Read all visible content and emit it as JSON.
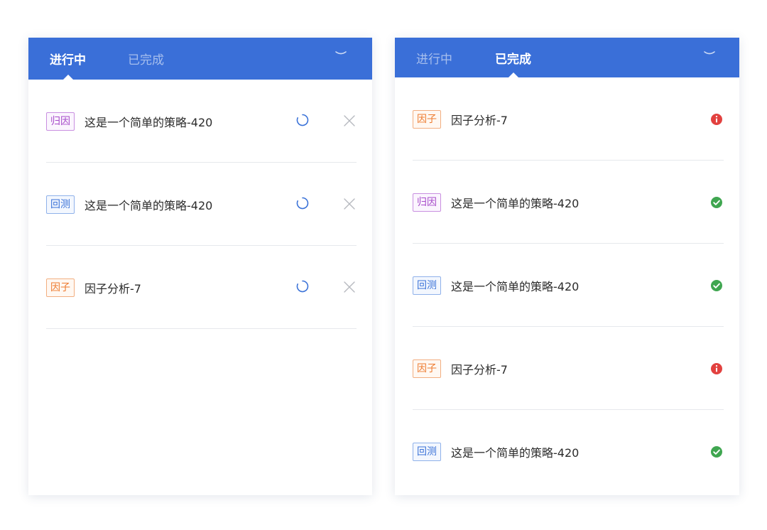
{
  "left_panel": {
    "tabs": [
      {
        "label": "进行中",
        "active": true
      },
      {
        "label": "已完成",
        "active": false
      }
    ],
    "tasks": [
      {
        "tag": "归因",
        "tag_type": "attr",
        "name": "这是一个简单的策略-420",
        "state": "running"
      },
      {
        "tag": "回测",
        "tag_type": "back",
        "name": "这是一个简单的策略-420",
        "state": "running"
      },
      {
        "tag": "因子",
        "tag_type": "factor",
        "name": "因子分析-7",
        "state": "running"
      }
    ]
  },
  "right_panel": {
    "tabs": [
      {
        "label": "进行中",
        "active": false
      },
      {
        "label": "已完成",
        "active": true
      }
    ],
    "tasks": [
      {
        "tag": "因子",
        "tag_type": "factor",
        "name": "因子分析-7",
        "status": "error"
      },
      {
        "tag": "归因",
        "tag_type": "attr",
        "name": "这是一个简单的策略-420",
        "status": "success"
      },
      {
        "tag": "回测",
        "tag_type": "back",
        "name": "这是一个简单的策略-420",
        "status": "success"
      },
      {
        "tag": "因子",
        "tag_type": "factor",
        "name": "因子分析-7",
        "status": "error"
      },
      {
        "tag": "回测",
        "tag_type": "back",
        "name": "这是一个简单的策略-420",
        "status": "success"
      }
    ]
  },
  "icons": {
    "collapse": "chevron-down-icon",
    "running": "loading-spinner-icon",
    "remove": "close-icon",
    "success": "check-circle-icon",
    "error": "exclamation-circle-icon"
  },
  "colors": {
    "header_bg": "#3a6fd8",
    "tag_attr": "#a64ac9",
    "tag_back": "#3a72d8",
    "tag_factor": "#ee7a2e",
    "success": "#3fa650",
    "error": "#e2413f",
    "spinner": "#3a72d8",
    "close": "#b6b9bf"
  }
}
